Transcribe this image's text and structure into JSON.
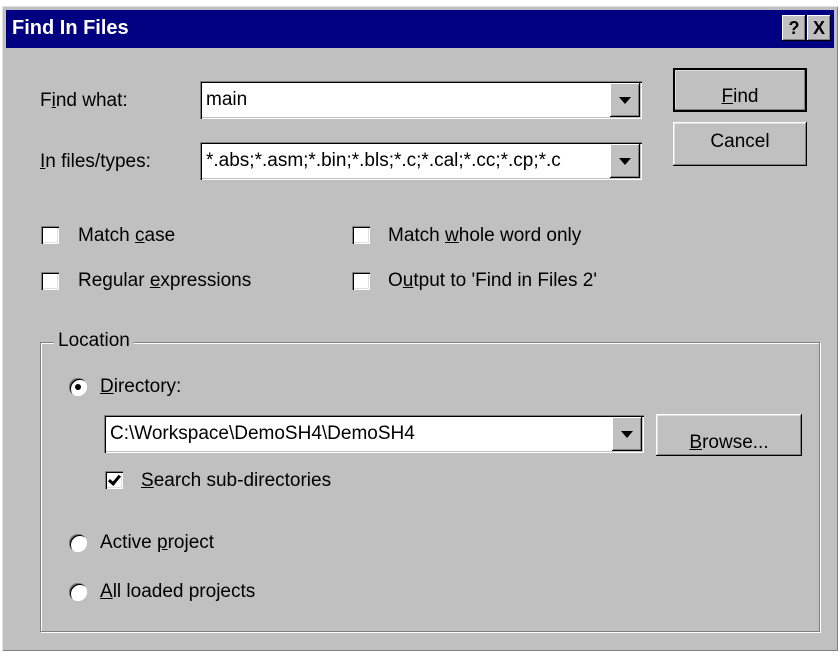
{
  "dialog": {
    "title": "Find In Files",
    "help_button": "?",
    "close_button": "X"
  },
  "find_what": {
    "label_pre": "F",
    "label_ul": "i",
    "label_post": "nd what:",
    "value": "main"
  },
  "in_files": {
    "label_pre": "",
    "label_ul": "I",
    "label_post": "n files/types:",
    "value": "*.abs;*.asm;*.bin;*.bls;*.c;*.cal;*.cc;*.cp;*.c"
  },
  "buttons": {
    "find_ul": "F",
    "find_post": "ind",
    "cancel": "Cancel"
  },
  "options": {
    "match_case_pre": "Match ",
    "match_case_ul": "c",
    "match_case_post": "ase",
    "regex_pre": "Regular ",
    "regex_ul": "e",
    "regex_post": "xpressions",
    "whole_word_pre": "Match ",
    "whole_word_ul": "w",
    "whole_word_post": "hole word only",
    "output_pre": "O",
    "output_ul": "u",
    "output_post": "tput to 'Find in Files 2'"
  },
  "location": {
    "group_title": "Location",
    "directory_ul": "D",
    "directory_post": "irectory:",
    "directory_value": "C:\\Workspace\\DemoSH4\\DemoSH4",
    "browse_ul": "B",
    "browse_post": "rowse...",
    "subdirs_ul": "S",
    "subdirs_post": "earch sub-directories",
    "active_pre": "Active ",
    "active_ul": "p",
    "active_post": "roject",
    "all_ul": "A",
    "all_post": "ll loaded projects"
  },
  "state": {
    "match_case": false,
    "regex": false,
    "whole_word": false,
    "output_2": false,
    "search_subdirs": true,
    "location_selected": "Directory"
  }
}
